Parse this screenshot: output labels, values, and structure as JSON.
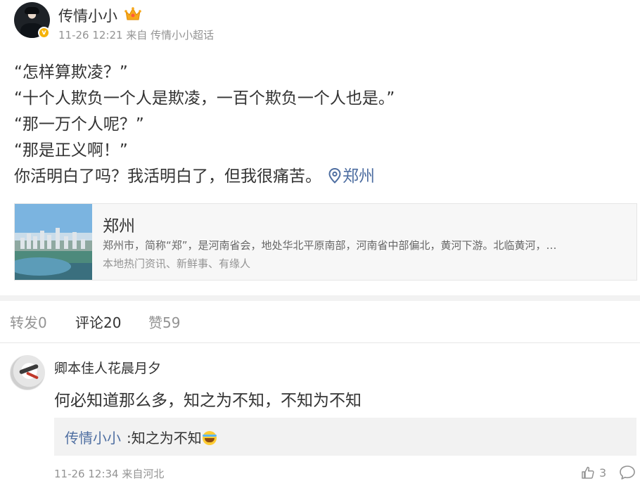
{
  "post": {
    "author": "传情小小",
    "meta_time": "11-26 12:21",
    "meta_from": "来自",
    "meta_source": "传情小小超话",
    "lines": [
      "“怎样算欺凌？”",
      "“十个人欺负一个人是欺凌，一百个欺负一个人也是。”",
      "“那一万个人呢？”",
      "“那是正义啊！”",
      "你活明白了吗？我活明白了，但我很痛苦。"
    ],
    "location_link": "郑州",
    "icons": [
      "crown-icon",
      "verified-icon",
      "location-pin-icon"
    ]
  },
  "location_card": {
    "title": "郑州",
    "description": "郑州市，简称“郑”，是河南省会，地处华北平原南部，河南省中部偏北，黄河下游。北临黄河，…",
    "subtitle": "本地热门资讯、新鲜事、有缘人"
  },
  "tabs": {
    "repost": "转发0",
    "comment": "评论20",
    "like": "赞59",
    "active": "comment"
  },
  "comment": {
    "author": "卿本佳人花晨月夕",
    "text": "何必知道那么多，知之为不知，不知为不知",
    "reply_author": "传情小小",
    "reply_text": ":知之为不知",
    "reply_emoji": "laugh-cry-emoji-icon",
    "meta": "11-26 12:34 来自河北",
    "like_count": "3",
    "icons": [
      "thumbs-up-icon",
      "comment-icon"
    ]
  },
  "colors": {
    "link": "#4e6ea1",
    "muted": "#939393",
    "text": "#333333",
    "badge": "#f5b30a"
  }
}
